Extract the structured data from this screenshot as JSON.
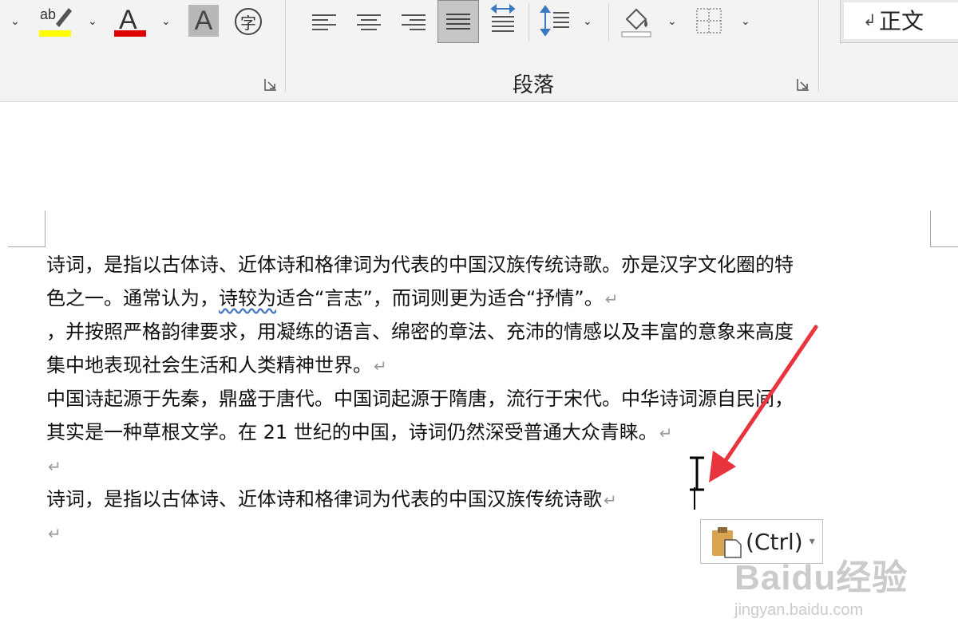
{
  "ribbon": {
    "paragraph_group_label": "段落",
    "style_name": "正文",
    "style_mark": "↲",
    "char_border_glyph": "字",
    "font_color_glyph": "A",
    "shaded_glyph": "A",
    "highlight_glyph": "ab",
    "highlight_color": "#ffff00",
    "font_color": "#e00000",
    "icons": [
      "highlight-icon",
      "font-color-icon",
      "char-shading-icon",
      "enclose-char-icon",
      "align-left-icon",
      "align-center-icon",
      "align-right-icon",
      "justify-icon",
      "distributed-icon",
      "line-spacing-icon",
      "shading-icon",
      "borders-icon"
    ]
  },
  "document": {
    "paragraphs": [
      {
        "line1": "诗词，是指以古体诗、近体诗和格律词为代表的中国汉族传统诗歌。亦是汉字文化圈的特",
        "line2a": "色之一。通常认为，",
        "line2b": "诗较为",
        "line2c": "适合“言志”，而词则更为适合“抒情”。"
      },
      {
        "line1": "，并按照严格韵律要求，用凝练的语言、绵密的章法、充沛的情感以及丰富的意象来高度",
        "line2": "集中地表现社会生活和人类精神世界。"
      },
      {
        "line1": "中国诗起源于先秦，鼎盛于唐代。中国词起源于隋唐，流行于宋代。中华诗词源自民间，",
        "line2": "其实是一种草根文学。在 21 世纪的中国，诗词仍然深受普通大众青睐。"
      },
      {
        "line1": ""
      },
      {
        "line1": "诗词，是指以古体诗、近体诗和格律词为代表的中国汉族传统诗歌"
      },
      {
        "line1": ""
      }
    ],
    "paragraph_mark": "↵"
  },
  "paste_options": {
    "label": "(Ctrl)"
  },
  "watermark": {
    "brand": "Baidu经验",
    "url": "jingyan.baidu.com"
  }
}
